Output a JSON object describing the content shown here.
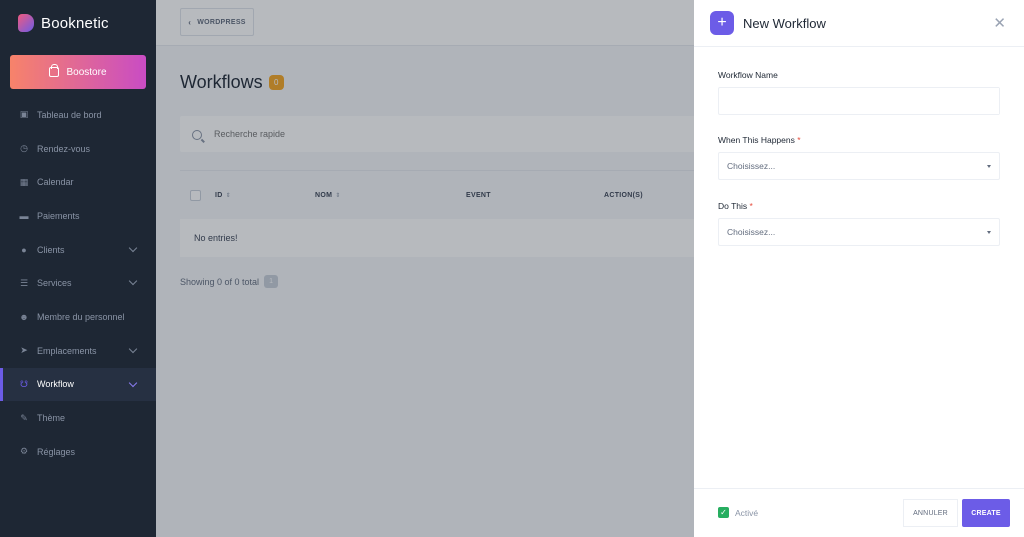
{
  "brand": {
    "name": "Booknetic"
  },
  "sidebar": {
    "boostore_label": "Boostore",
    "items": [
      {
        "label": "Tableau de bord",
        "icon": "cube-icon"
      },
      {
        "label": "Rendez-vous",
        "icon": "clock-icon"
      },
      {
        "label": "Calendar",
        "icon": "calendar-icon"
      },
      {
        "label": "Paiements",
        "icon": "credit-card-icon"
      },
      {
        "label": "Clients",
        "icon": "users-icon"
      },
      {
        "label": "Services",
        "icon": "list-icon"
      },
      {
        "label": "Membre du personnel",
        "icon": "user-icon"
      },
      {
        "label": "Emplacements",
        "icon": "location-arrow-icon"
      },
      {
        "label": "Workflow",
        "icon": "workflow-icon"
      },
      {
        "label": "Thème",
        "icon": "brush-icon"
      },
      {
        "label": "Réglages",
        "icon": "gear-icon"
      }
    ]
  },
  "main": {
    "wordpress_label": "WORDPRESS",
    "title": "Workflows",
    "count": "0",
    "search_placeholder": "Recherche rapide",
    "table": {
      "columns": [
        "ID",
        "NOM",
        "EVENT",
        "ACTION(S)"
      ],
      "empty_text": "No entries!"
    },
    "showing_text": "Showing 0 of 0 total",
    "page": "1"
  },
  "panel": {
    "title": "New Workflow",
    "fields": {
      "name_label": "Workflow Name",
      "name_value": "",
      "when_label": "When This Happens",
      "when_value": "Choisissez...",
      "do_label": "Do This",
      "do_value": "Choisissez...",
      "required_mark": "*"
    },
    "footer": {
      "active_label": "Activé",
      "active_checked": true,
      "cancel_label": "ANNULER",
      "create_label": "CREATE"
    }
  },
  "colors": {
    "accent": "#6c5ce7",
    "sidebar_bg": "#1e2734",
    "badge": "#f5a623",
    "check": "#27ae60"
  }
}
